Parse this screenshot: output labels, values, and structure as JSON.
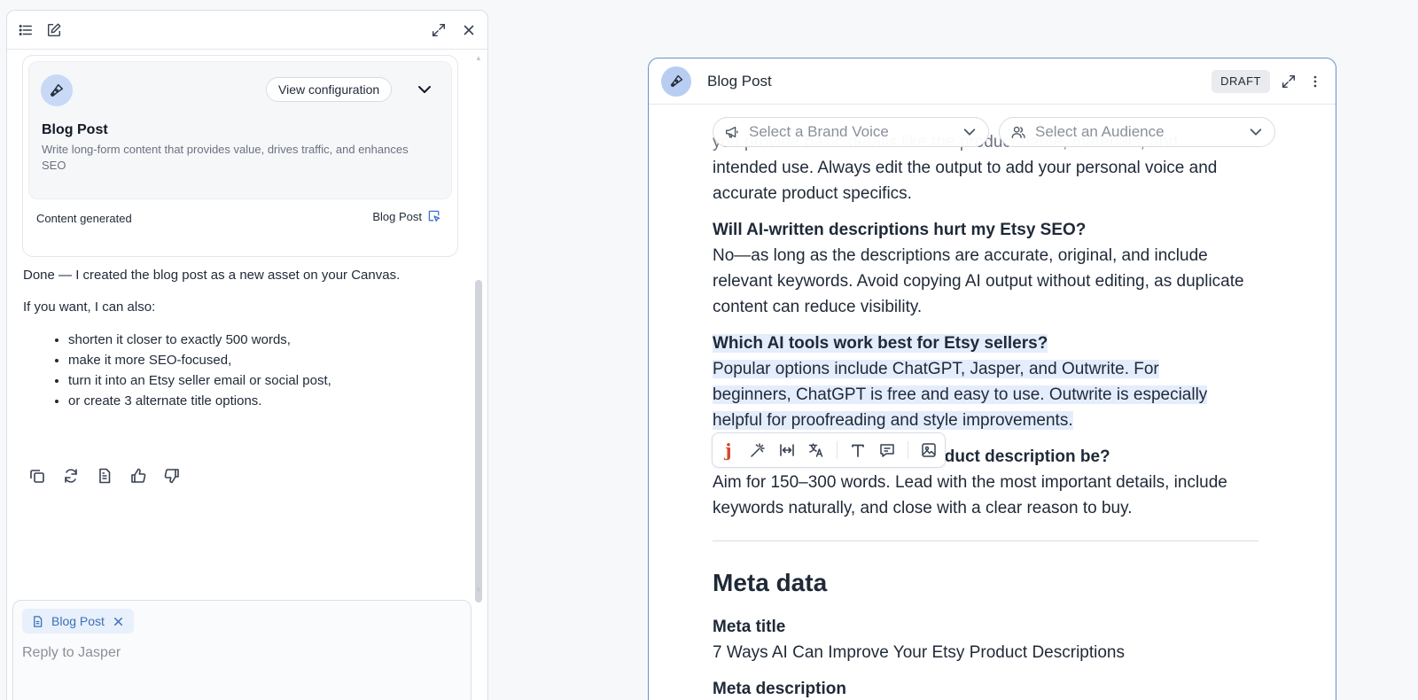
{
  "chat": {
    "tool_card": {
      "view_config_label": "View configuration",
      "title": "Blog Post",
      "description": "Write long-form content that provides value, drives traffic, and enhances SEO",
      "status": "Content generated",
      "link_label": "Blog Post"
    },
    "reply": {
      "p1": "Done — I created the blog post as a new asset on your Canvas.",
      "p2": "If you want, I can also:",
      "items": [
        "shorten it closer to exactly 500 words,",
        "make it more SEO-focused,",
        "turn it into an Etsy seller email or social post,",
        "or create 3 alternate title options."
      ]
    },
    "composer": {
      "chip_label": "Blog Post",
      "placeholder": "Reply to Jasper"
    }
  },
  "doc": {
    "title": "Blog Post",
    "badge": "DRAFT",
    "brand_voice_placeholder": "Select a Brand Voice",
    "audience_placeholder": "Select an Audience",
    "partial_line": "you provide basic details like the product name, materials, and",
    "para0": "intended use. Always edit the output to add your personal voice and accurate product specifics.",
    "q1": "Will AI-written descriptions hurt my Etsy SEO?",
    "a1": "No—as long as the descriptions are accurate, original, and include relevant keywords. Avoid copying AI output without editing, as duplicate content can reduce visibility.",
    "q2": "Which AI tools work best for Etsy sellers?",
    "a2_l1": "Popular options include ChatGPT, Jasper, and Outwrite. For",
    "a2_l2": "beginners, ChatGPT is free and easy to use. Outwrite is especially",
    "a2_l3": "helpful for proofreading and style improvements.",
    "q3": "How long should an Etsy product description be?",
    "a3": "Aim for 150–300 words. Lead with the most important details, include keywords naturally, and close with a clear reason to buy.",
    "meta_heading": "Meta data",
    "meta_title_label": "Meta title",
    "meta_title_value": "7 Ways AI Can Improve Your Etsy Product Descriptions",
    "meta_desc_label": "Meta description"
  },
  "colors": {
    "accent": "#3b6fd8",
    "highlight": "#e4edfb",
    "jasper_brand": "#d14b2a",
    "doc_border": "#6b8fcc"
  },
  "icons": [
    "list-icon",
    "edit-icon",
    "expand-icon",
    "close-icon",
    "pen-icon",
    "chevron-down-icon",
    "open-canvas-icon",
    "copy-icon",
    "refresh-icon",
    "document-icon",
    "thumbs-up-icon",
    "thumbs-down-icon",
    "megaphone-icon",
    "users-icon",
    "magic-wand-icon",
    "width-icon",
    "translate-icon",
    "text-icon",
    "comment-icon",
    "image-icon",
    "more-vertical-icon"
  ]
}
